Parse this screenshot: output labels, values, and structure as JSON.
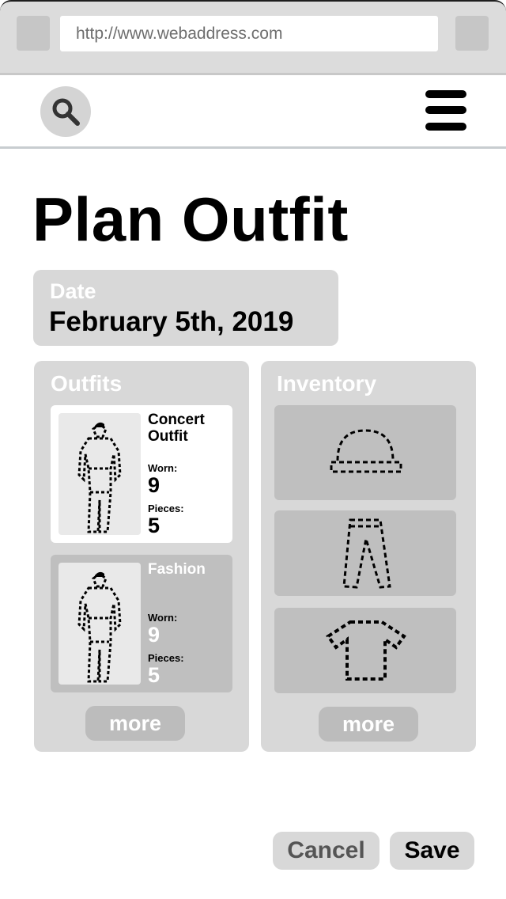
{
  "browser": {
    "url": "http://www.webaddress.com",
    "icons": [
      "back-button-icon",
      "forward-button-icon"
    ]
  },
  "nav": {
    "icons": [
      "search-icon",
      "hamburger-menu-icon"
    ]
  },
  "page": {
    "title": "Plan Outfit"
  },
  "date_card": {
    "label": "Date",
    "value": "February 5th, 2019"
  },
  "outfits": {
    "title": "Outfits",
    "items": [
      {
        "name": "Concert Outfit",
        "worn_label": "Worn:",
        "worn": "9",
        "pieces_label": "Pieces:",
        "pieces": "5",
        "selected": true
      },
      {
        "name": "Fashion",
        "worn_label": "Worn:",
        "worn": "9",
        "pieces_label": "Pieces:",
        "pieces": "5",
        "selected": false
      }
    ],
    "more_label": "more"
  },
  "inventory": {
    "title": "Inventory",
    "items": [
      {
        "icon": "hat-icon"
      },
      {
        "icon": "pants-icon"
      },
      {
        "icon": "shirt-icon"
      }
    ],
    "more_label": "more"
  },
  "actions": {
    "cancel_label": "Cancel",
    "save_label": "Save"
  },
  "colors": {
    "panel": "#d8d8d8",
    "item_bg": "#bfbfbf",
    "selected_card": "#ffffff",
    "unselected_card": "#bfbfbf",
    "cancel_text": "#555555"
  }
}
